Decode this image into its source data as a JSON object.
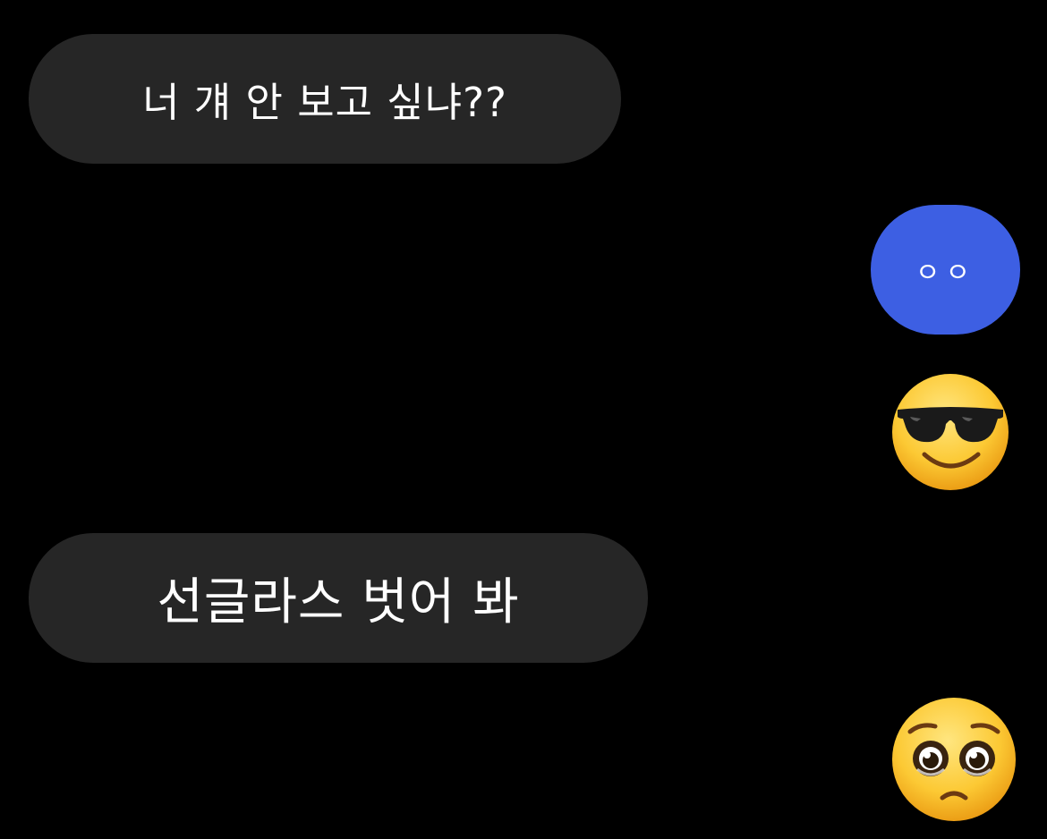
{
  "messages": [
    {
      "side": "received",
      "text": "너 걔 안 보고 싶냐??"
    },
    {
      "side": "sent",
      "text": "ㅇㅇ"
    },
    {
      "side": "sent",
      "emoji": "smiling-face-with-sunglasses-icon"
    },
    {
      "side": "received",
      "text": "선글라스 벗어 봐"
    },
    {
      "side": "sent",
      "emoji": "pleading-face-icon"
    }
  ],
  "colors": {
    "background": "#000000",
    "received_bubble": "#262626",
    "sent_bubble": "#3d5fe3",
    "text": "#ffffff"
  }
}
